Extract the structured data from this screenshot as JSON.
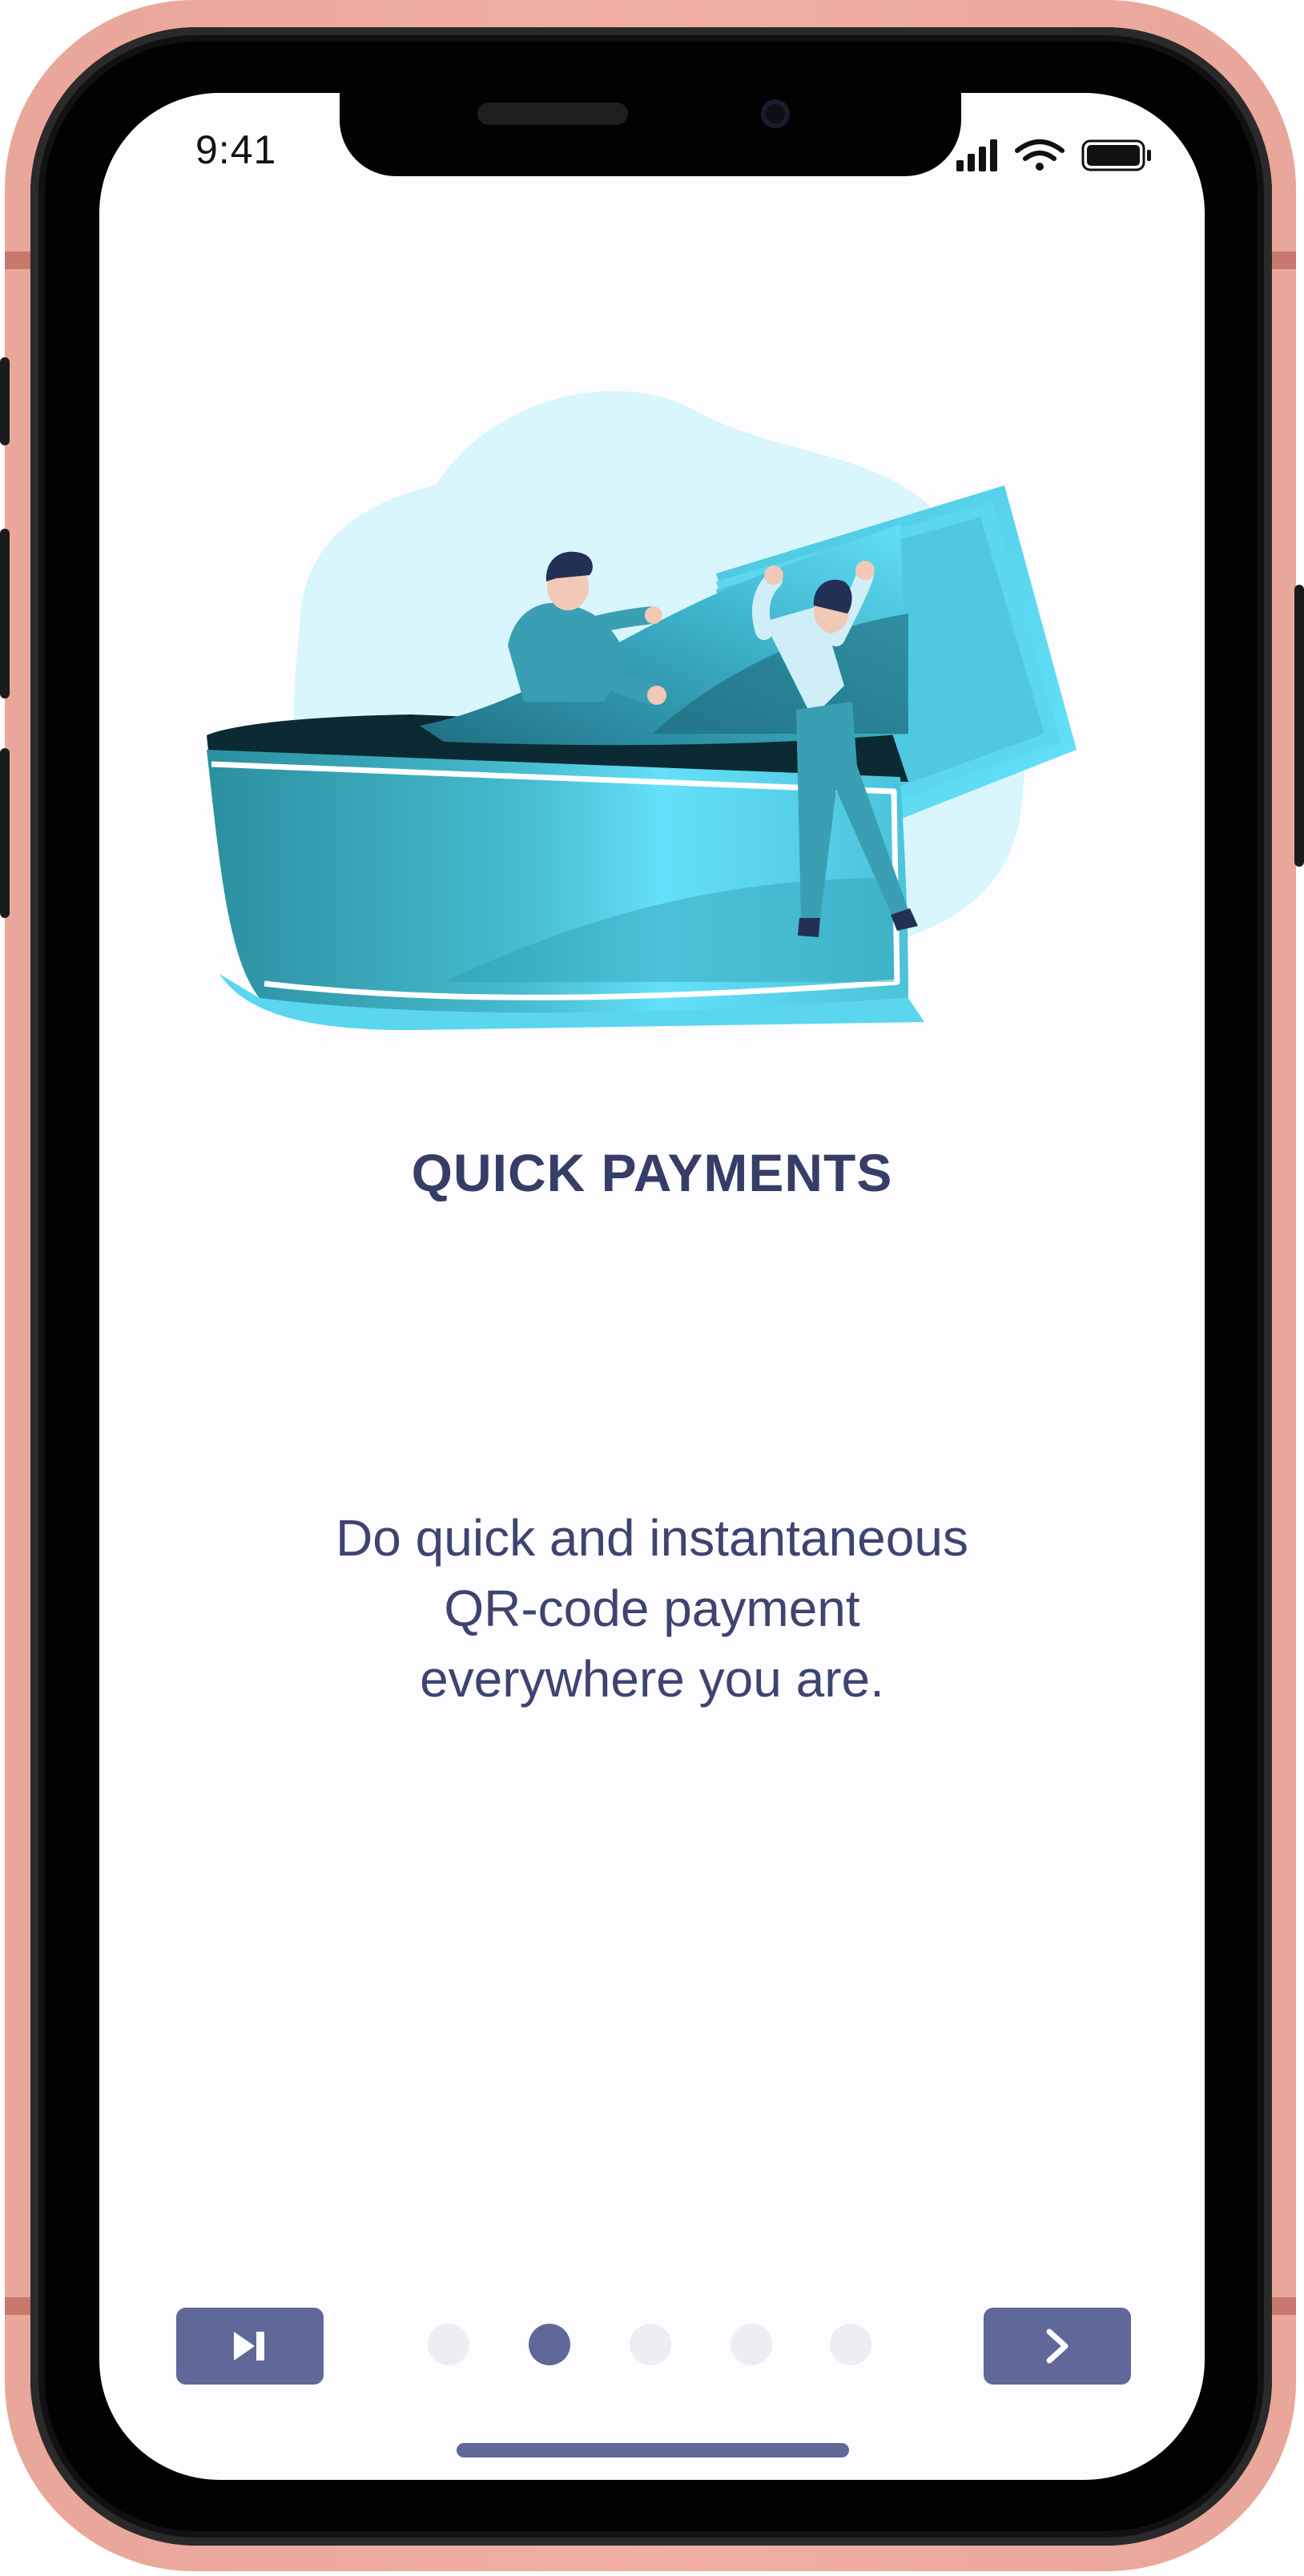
{
  "status_bar": {
    "time": "9:41",
    "icons": [
      "cellular-signal-icon",
      "wifi-icon",
      "battery-icon"
    ]
  },
  "onboarding": {
    "illustration": "wallet-with-money-illustration",
    "title": "QUICK PAYMENTS",
    "description_lines": [
      "Do quick and instantaneous",
      "QR-code payment",
      "everywhere you are."
    ]
  },
  "pager": {
    "total": 5,
    "active_index": 1
  },
  "buttons": {
    "skip_icon": "skip-forward-icon",
    "next_icon": "chevron-right-icon"
  },
  "colors": {
    "frame": "#f0afa3",
    "accent": "#5f6899",
    "title": "#363d66",
    "text": "#3e4470",
    "dot_inactive": "#eeeef2",
    "illustration_cyan": "#62e0fa",
    "illustration_teal": "#2f96a8"
  }
}
